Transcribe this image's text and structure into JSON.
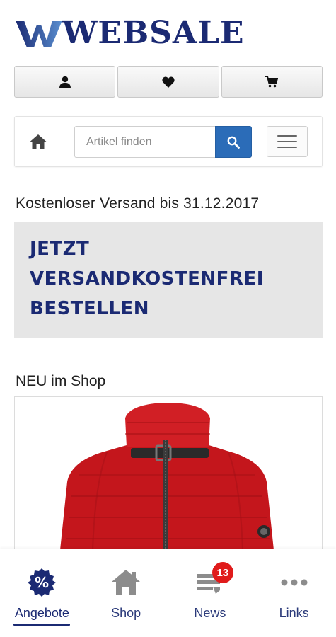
{
  "logo": {
    "text": "WEBSALE"
  },
  "actions": [
    {
      "icon": "user-icon"
    },
    {
      "icon": "heart-icon"
    },
    {
      "icon": "cart-icon"
    }
  ],
  "search": {
    "home_icon": "home-icon",
    "placeholder": "Artikel finden",
    "value": "",
    "button_icon": "search-icon",
    "menu_icon": "hamburger-menu-icon"
  },
  "promo": {
    "shipping_text": "Kostenloser Versand bis 31.12.2017",
    "banner_line1": "JETZT",
    "banner_line2": "VERSANDKOSTENFREI",
    "banner_line3": "BESTELLEN"
  },
  "new_in_shop": {
    "title": "NEU im Shop",
    "image": "red-jacket"
  },
  "bottom_nav": {
    "items": [
      {
        "label": "Angebote",
        "icon": "percent-badge-icon",
        "active": true
      },
      {
        "label": "Shop",
        "icon": "home-icon"
      },
      {
        "label": "News",
        "icon": "news-icon",
        "badge": "13"
      },
      {
        "label": "Links",
        "icon": "more-icon"
      }
    ]
  },
  "colors": {
    "brand": "#1b2a73",
    "search_button": "#2b6cb8",
    "badge": "#e01b1b",
    "jacket": "#c4161c",
    "banner_bg": "#e6e6e6"
  }
}
